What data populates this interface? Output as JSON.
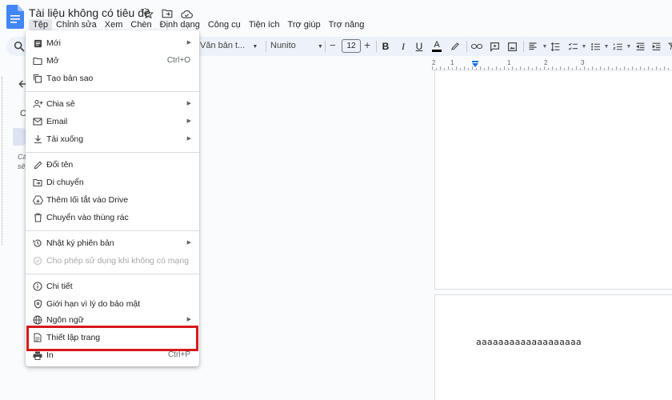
{
  "document": {
    "title": "Tài liệu không có tiêu đề",
    "body_text": "aaaaaaaaaaaaaaaaaaa"
  },
  "menubar": [
    {
      "label": "Tệp",
      "active": true
    },
    {
      "label": "Chỉnh sửa"
    },
    {
      "label": "Xem"
    },
    {
      "label": "Chèn"
    },
    {
      "label": "Định dạng"
    },
    {
      "label": "Công cụ"
    },
    {
      "label": "Tiện ích"
    },
    {
      "label": "Trợ giúp"
    },
    {
      "label": "Trợ năng"
    }
  ],
  "toolbar": {
    "style_value": "Văn bản t...",
    "font_value": "Nunito",
    "font_size": "12",
    "minus": "−",
    "plus": "+"
  },
  "ruler": {
    "labels": [
      "2",
      "1",
      "1",
      "2",
      "3"
    ]
  },
  "sidebar": {
    "heading_fragment": "C",
    "hint_line1": "Cá",
    "hint_line2": "sẽ"
  },
  "file_menu": {
    "items": [
      {
        "label": "Mới",
        "icon": "document-icon",
        "submenu": true
      },
      {
        "label": "Mở",
        "icon": "folder-icon",
        "shortcut": "Ctrl+O"
      },
      {
        "label": "Tạo bản sao",
        "icon": "copy-icon"
      },
      {
        "label": "Chia sẻ",
        "icon": "share-person-icon",
        "submenu": true
      },
      {
        "label": "Email",
        "icon": "email-icon",
        "submenu": true
      },
      {
        "label": "Tải xuống",
        "icon": "download-icon",
        "submenu": true
      },
      {
        "label": "Đổi tên",
        "icon": "pencil-icon"
      },
      {
        "label": "Di chuyển",
        "icon": "move-folder-icon"
      },
      {
        "label": "Thêm lối tắt vào Drive",
        "icon": "drive-shortcut-icon"
      },
      {
        "label": "Chuyển vào thùng rác",
        "icon": "trash-icon"
      },
      {
        "label": "Nhật ký phiên bản",
        "icon": "history-icon",
        "submenu": true
      },
      {
        "label": "Cho phép sử dụng khi không có mạng",
        "icon": "offline-icon",
        "disabled": true
      },
      {
        "label": "Chi tiết",
        "icon": "info-icon"
      },
      {
        "label": "Giới hạn vì lý do bảo mật",
        "icon": "security-shield-icon"
      },
      {
        "label": "Ngôn ngữ",
        "icon": "globe-icon",
        "submenu": true
      },
      {
        "label": "Thiết lập trang",
        "icon": "page-setup-icon"
      },
      {
        "label": "In",
        "icon": "printer-icon",
        "shortcut": "Ctrl+P"
      }
    ]
  },
  "colors": {
    "accent": "#1a73e8",
    "highlight_border": "#d7191c",
    "toolbar_bg": "#edf2fa"
  }
}
